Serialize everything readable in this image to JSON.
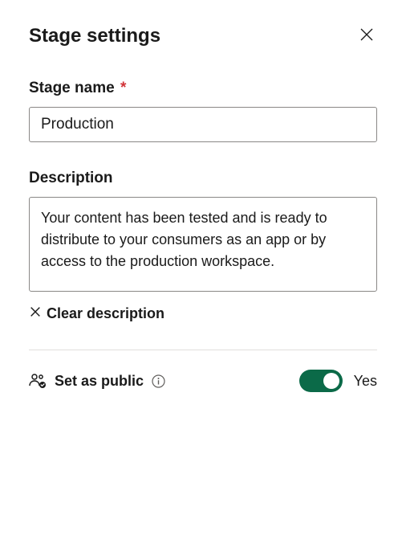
{
  "header": {
    "title": "Stage settings"
  },
  "fields": {
    "stageName": {
      "label": "Stage name",
      "required": "*",
      "value": "Production"
    },
    "description": {
      "label": "Description",
      "value": "Your content has been tested and is ready to distribute to your consumers as an app or by access to the production workspace.",
      "clearLabel": "Clear description"
    }
  },
  "public": {
    "label": "Set as public",
    "toggleState": "Yes"
  },
  "colors": {
    "toggleOn": "#0b6a48",
    "required": "#d13438"
  }
}
